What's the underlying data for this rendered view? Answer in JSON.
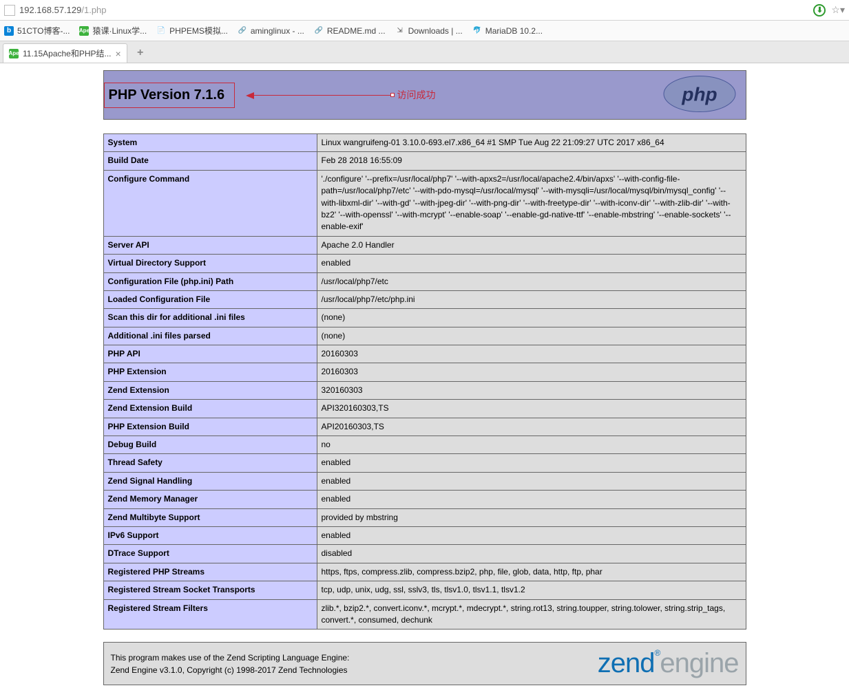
{
  "address": {
    "host": "192.168.57.129",
    "path": "/1.php"
  },
  "bookmarks": [
    "51CTO博客-...",
    "猿课·Linux学...",
    "PHPEMS模拟...",
    "aminglinux - ...",
    "README.md ...",
    "Downloads | ...",
    "MariaDB 10.2..."
  ],
  "tab": {
    "title": "11.15Apache和PHP结..."
  },
  "php_header": {
    "title": "PHP Version 7.1.6",
    "annotation": "访问成功"
  },
  "rows": [
    {
      "k": "System",
      "v": "Linux wangruifeng-01 3.10.0-693.el7.x86_64 #1 SMP Tue Aug 22 21:09:27 UTC 2017 x86_64"
    },
    {
      "k": "Build Date",
      "v": "Feb 28 2018 16:55:09"
    },
    {
      "k": "Configure Command",
      "v": "'./configure' '--prefix=/usr/local/php7' '--with-apxs2=/usr/local/apache2.4/bin/apxs' '--with-config-file-path=/usr/local/php7/etc' '--with-pdo-mysql=/usr/local/mysql' '--with-mysqli=/usr/local/mysql/bin/mysql_config' '--with-libxml-dir' '--with-gd' '--with-jpeg-dir' '--with-png-dir' '--with-freetype-dir' '--with-iconv-dir' '--with-zlib-dir' '--with-bz2' '--with-openssl' '--with-mcrypt' '--enable-soap' '--enable-gd-native-ttf' '--enable-mbstring' '--enable-sockets' '--enable-exif'"
    },
    {
      "k": "Server API",
      "v": "Apache 2.0 Handler"
    },
    {
      "k": "Virtual Directory Support",
      "v": "enabled"
    },
    {
      "k": "Configuration File (php.ini) Path",
      "v": "/usr/local/php7/etc"
    },
    {
      "k": "Loaded Configuration File",
      "v": "/usr/local/php7/etc/php.ini"
    },
    {
      "k": "Scan this dir for additional .ini files",
      "v": "(none)"
    },
    {
      "k": "Additional .ini files parsed",
      "v": "(none)"
    },
    {
      "k": "PHP API",
      "v": "20160303"
    },
    {
      "k": "PHP Extension",
      "v": "20160303"
    },
    {
      "k": "Zend Extension",
      "v": "320160303"
    },
    {
      "k": "Zend Extension Build",
      "v": "API320160303,TS"
    },
    {
      "k": "PHP Extension Build",
      "v": "API20160303,TS"
    },
    {
      "k": "Debug Build",
      "v": "no"
    },
    {
      "k": "Thread Safety",
      "v": "enabled"
    },
    {
      "k": "Zend Signal Handling",
      "v": "enabled"
    },
    {
      "k": "Zend Memory Manager",
      "v": "enabled"
    },
    {
      "k": "Zend Multibyte Support",
      "v": "provided by mbstring"
    },
    {
      "k": "IPv6 Support",
      "v": "enabled"
    },
    {
      "k": "DTrace Support",
      "v": "disabled"
    },
    {
      "k": "Registered PHP Streams",
      "v": "https, ftps, compress.zlib, compress.bzip2, php, file, glob, data, http, ftp, phar"
    },
    {
      "k": "Registered Stream Socket Transports",
      "v": "tcp, udp, unix, udg, ssl, sslv3, tls, tlsv1.0, tlsv1.1, tlsv1.2"
    },
    {
      "k": "Registered Stream Filters",
      "v": "zlib.*, bzip2.*, convert.iconv.*, mcrypt.*, mdecrypt.*, string.rot13, string.toupper, string.tolower, string.strip_tags, convert.*, consumed, dechunk"
    }
  ],
  "zend": {
    "line1": "This program makes use of the Zend Scripting Language Engine:",
    "line2": "Zend Engine v3.1.0, Copyright (c) 1998-2017 Zend Technologies"
  }
}
